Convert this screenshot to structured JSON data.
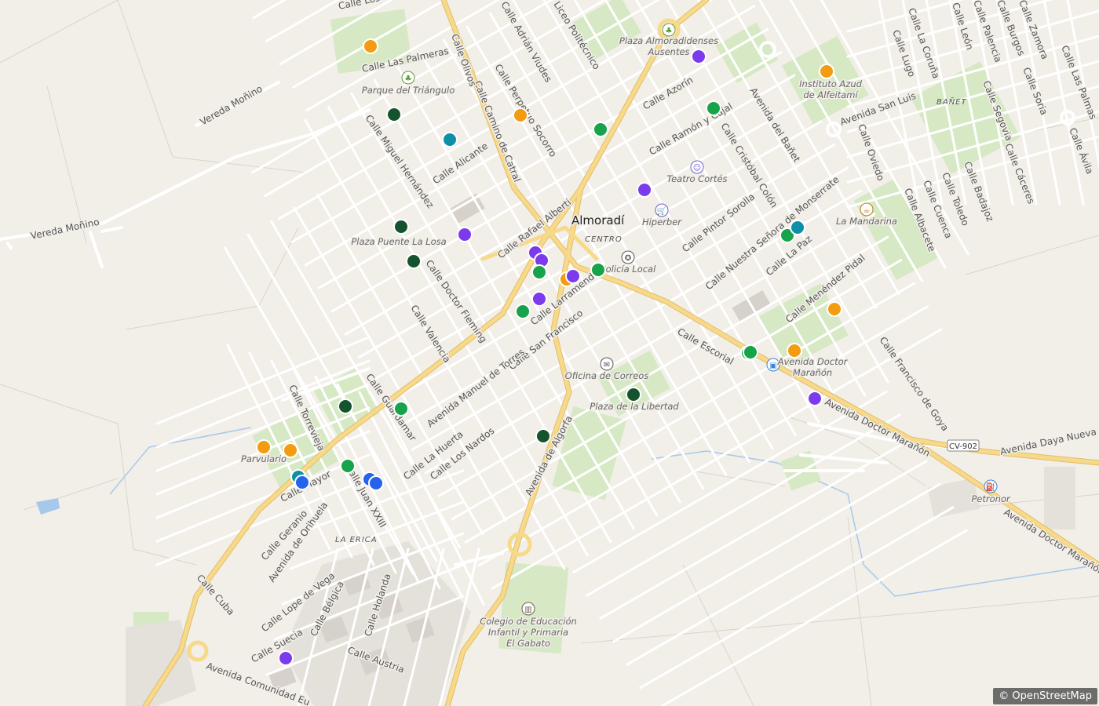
{
  "map": {
    "place_name": "Almoradí",
    "district_labels": [
      "CENTRO",
      "LA ERICA",
      "BAÑET"
    ],
    "route_shield": "CV-902",
    "attribution": "© OpenStreetMap"
  },
  "streets": [
    "Calle Los",
    "Calle Las Palmeras",
    "Vereda Moñino",
    "Vereda Moñino",
    "Calle Miguel Hernández",
    "Calle Alicante",
    "Calle Camino de Catral",
    "Calle Perpetuo Socorro",
    "Calle Adrián Viudes",
    "Liceo Politécnico",
    "Calle Rafael Alberti",
    "Calle Azorín",
    "Calle Ramón y Cajal",
    "Calle Cristóbal Colón",
    "Avenida del Bañet",
    "Avenida San Luis",
    "Calle Oviedo",
    "Calle Lugo",
    "Calle La Coruña",
    "Calle León",
    "Calle Palencia",
    "Calle Burgos",
    "Calle Zamora",
    "Calle Las Palmas",
    "Calle Segovia",
    "Calle Soria",
    "Calle Ávila",
    "Calle Cáceres",
    "Calle Badajoz",
    "Calle Toledo",
    "Calle Cuenca",
    "Calle Albacete",
    "Calle Doctor Fleming",
    "Calle Valencia",
    "Calle Larramendi",
    "Calle San Francisco",
    "Avenida Manuel de Torres",
    "Calle Guardamar",
    "Calle Pintor Sorolla",
    "Calle Nuestra Señora de Monserrate",
    "Calle La Paz",
    "Calle Menéndez Pidal",
    "Calle Escorial",
    "Calle Francisco de Goya",
    "Avenida Doctor Marañón",
    "Avenida Doctor Marañón",
    "Avenida Daya Nueva",
    "Calle Torrevieja",
    "Calle Mayor",
    "Calle Juan XXIII",
    "Calle La Huerta",
    "Calle Los Nardos",
    "Avenida de Algorfa",
    "Calle Geranio",
    "Avenida de Orihuela",
    "Calle Cuba",
    "Calle Lope de Vega",
    "Calle Bélgica",
    "Calle Holanda",
    "Calle Suecia",
    "Calle Austria",
    "Avenida Comunidad Eu",
    "Calle Olivos"
  ],
  "pois": [
    {
      "label": "Plaza Almoradidenses Ausentes",
      "icon": "park-icon"
    },
    {
      "label": "Parque del Triángulo",
      "icon": "park-icon"
    },
    {
      "label": "Instituto Azud de Alfeitamí",
      "icon": "school-icon"
    },
    {
      "label": "Teatro Cortés",
      "icon": "theatre-icon"
    },
    {
      "label": "Hiperber",
      "icon": "shop-icon"
    },
    {
      "label": "La Mandarina",
      "icon": "cafe-icon"
    },
    {
      "label": "Plaza Puente La Losa",
      "icon": ""
    },
    {
      "label": "Policía Local",
      "icon": "police-icon"
    },
    {
      "label": "Avenida Doctor Marañón",
      "icon": "bus-stop-icon"
    },
    {
      "label": "Oficina de Correos",
      "icon": "post-office-icon"
    },
    {
      "label": "Plaza de la Libertad",
      "icon": ""
    },
    {
      "label": "Parvulario",
      "icon": ""
    },
    {
      "label": "Petronor",
      "icon": "fuel-icon"
    },
    {
      "label": "Colegio de Educación Infantil y Primaria El Gabato",
      "icon": "school-icon"
    }
  ],
  "colors": {
    "background": "#f2efe9",
    "road": "#ffffff",
    "major_road": "#f7d98a",
    "park": "#d6e9c4",
    "water": "#a6c8ec",
    "marker_orange": "#f39c12",
    "marker_purple": "#7c3aed",
    "marker_green": "#16a34a",
    "marker_darkgreen": "#14532d",
    "marker_teal": "#0e8fa8",
    "marker_blue": "#2563eb"
  },
  "markers": [
    {
      "category": "orange"
    },
    {
      "category": "orange"
    },
    {
      "category": "orange"
    },
    {
      "category": "orange"
    },
    {
      "category": "orange"
    },
    {
      "category": "orange"
    },
    {
      "category": "orange"
    },
    {
      "category": "orange"
    },
    {
      "category": "purple"
    },
    {
      "category": "purple"
    },
    {
      "category": "purple"
    },
    {
      "category": "purple"
    },
    {
      "category": "purple"
    },
    {
      "category": "purple"
    },
    {
      "category": "purple"
    },
    {
      "category": "purple"
    },
    {
      "category": "purple"
    },
    {
      "category": "purple"
    },
    {
      "category": "green"
    },
    {
      "category": "green"
    },
    {
      "category": "green"
    },
    {
      "category": "green"
    },
    {
      "category": "green"
    },
    {
      "category": "green"
    },
    {
      "category": "green"
    },
    {
      "category": "green"
    },
    {
      "category": "green"
    },
    {
      "category": "green"
    },
    {
      "category": "darkgreen"
    },
    {
      "category": "darkgreen"
    },
    {
      "category": "darkgreen"
    },
    {
      "category": "darkgreen"
    },
    {
      "category": "darkgreen"
    },
    {
      "category": "darkgreen"
    },
    {
      "category": "teal"
    },
    {
      "category": "teal"
    },
    {
      "category": "teal"
    },
    {
      "category": "blue"
    },
    {
      "category": "blue"
    },
    {
      "category": "blue"
    }
  ]
}
